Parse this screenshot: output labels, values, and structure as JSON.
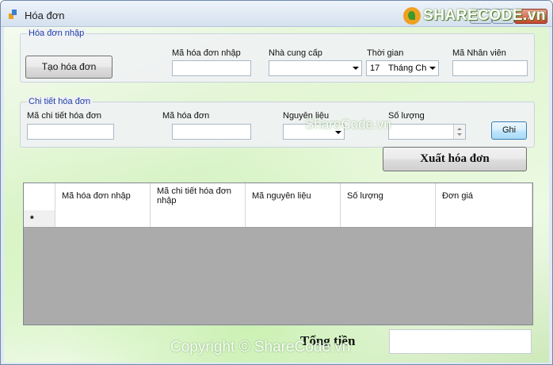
{
  "window": {
    "title": "Hóa đơn",
    "close_glyph": "X"
  },
  "logo": {
    "text": "SHARECODE.vn"
  },
  "group1": {
    "legend": "Hóa đơn nhập",
    "create_button": "Tạo hóa đơn",
    "ma_hoa_don_nhap_label": "Mã hóa đơn nhập",
    "ma_hoa_don_nhap_value": "",
    "nha_cung_cap_label": "Nhà cung cấp",
    "nha_cung_cap_value": "",
    "thoi_gian_label": "Thời gian",
    "thoi_gian_day": "17",
    "thoi_gian_month": "Tháng Ch",
    "ma_nhan_vien_label": "Mã Nhân viên",
    "ma_nhan_vien_value": ""
  },
  "group2": {
    "legend": "Chi tiết hóa đơn",
    "ma_chi_tiet_label": "Mã chi tiết hóa đơn",
    "ma_hoa_don_label": "Mã hóa đơn",
    "nguyen_lieu_label": "Nguyên liệu",
    "so_luong_label": "Số lượng",
    "ghi_button": "Ghi"
  },
  "xuat_button": "Xuất hóa đơn",
  "grid": {
    "columns": [
      "Mã hóa đơn nhập",
      "Mã chi tiết hóa đơn nhập",
      "Mã nguyên liệu",
      "Số lượng",
      "Đơn giá"
    ],
    "new_row_marker": "*"
  },
  "total": {
    "label": "Tổng tiền",
    "value": ""
  },
  "watermarks": {
    "footer": "Copyright © ShareCode.vn",
    "center": "ShareCode.vn"
  },
  "colors": {
    "accent": "#1f3fa8",
    "grid_bg": "#ababab"
  }
}
